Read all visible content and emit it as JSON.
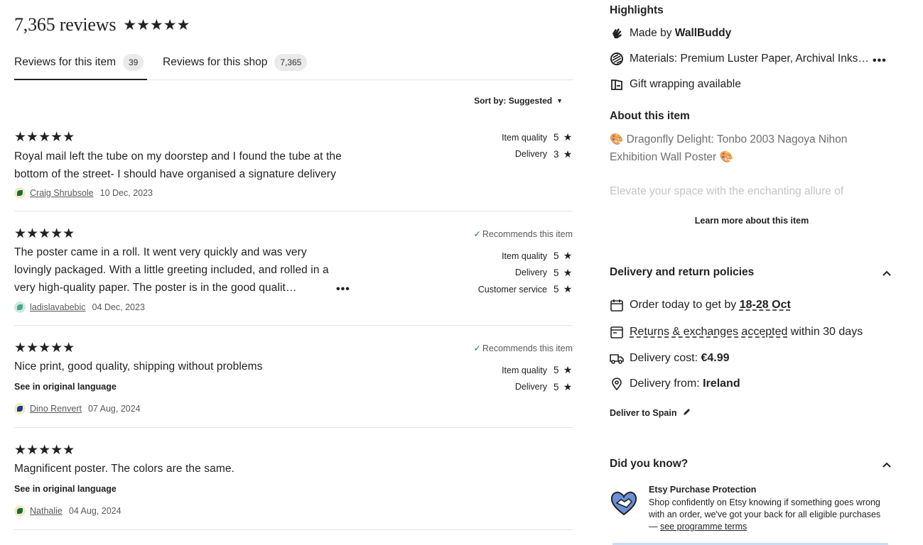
{
  "reviews_header": {
    "count_label": "7,365 reviews",
    "stars": "★★★★★"
  },
  "tabs": [
    {
      "label": "Reviews for this item",
      "count": "39"
    },
    {
      "label": "Reviews for this shop",
      "count": "7,365"
    }
  ],
  "sort": {
    "label": "Sort by: Suggested",
    "caret": "▼"
  },
  "reviews": [
    {
      "stars": "★★★★★",
      "text": "Royal mail left the tube on my doorstep and I found the tube at the bottom of the street- I should have organised a signature delivery",
      "author": "Craig Shrubsole",
      "date": "10 Dec, 2023",
      "ratings": [
        {
          "name": "Item quality",
          "value": "5"
        },
        {
          "name": "Delivery",
          "value": "3"
        }
      ]
    },
    {
      "stars": "★★★★★",
      "text": "The poster came in a roll. It went very quickly and was very lovingly packaged. With a little greeting included, and rolled in a very high-quality paper. The poster is in the good qualit…",
      "more": "•••",
      "author": "ladislavabebic",
      "date": "04 Dec, 2023",
      "recommends": "Recommends this item",
      "ratings": [
        {
          "name": "Item quality",
          "value": "5"
        },
        {
          "name": "Delivery",
          "value": "5"
        },
        {
          "name": "Customer service",
          "value": "5"
        }
      ]
    },
    {
      "stars": "★★★★★",
      "text": "Nice print, good quality, shipping without problems",
      "see_original": "See in original language",
      "author": "Dino Renvert",
      "date": "07 Aug, 2024",
      "recommends": "Recommends this item",
      "ratings": [
        {
          "name": "Item quality",
          "value": "5"
        },
        {
          "name": "Delivery",
          "value": "5"
        }
      ]
    },
    {
      "stars": "★★★★★",
      "text": "Magnificent poster. The colors are the same.",
      "see_original": "See in original language",
      "author": "Nathalie",
      "date": "04 Aug, 2024"
    }
  ],
  "details": {
    "highlights_title": "Highlights",
    "made_by_prefix": "Made by ",
    "made_by_shop": "WallBuddy",
    "materials": "Materials: Premium Luster Paper, Archival Inks, Acid-free",
    "materials_more": "•••",
    "gift_wrapping": "Gift wrapping available",
    "about_title": "About this item",
    "about_text": "🎨 Dragonfly Delight: Tonbo 2003 Nagoya Nihon Exhibition Wall Poster 🎨",
    "about_fade": "Elevate your space with the enchanting allure of",
    "learn_more": "Learn more about this item",
    "delivery_title": "Delivery and return policies",
    "order_prefix": "Order today to get by ",
    "order_dates": "18-28 Oct",
    "returns_link": "Returns & exchanges accepted",
    "returns_suffix": " within 30 days",
    "cost_prefix": "Delivery cost: ",
    "cost_value": "€4.99",
    "from_prefix": "Delivery from: ",
    "from_value": "Ireland",
    "deliver_to": "Deliver to Spain",
    "did_you_know": "Did you know?",
    "protection_title": "Etsy Purchase Protection",
    "protection_body": "Shop confidently on Etsy knowing if something goes wrong with an order, we've got your back for all eligible purchases — ",
    "protection_link": "see programme terms"
  },
  "colors": {
    "recommend_check": "#258635",
    "text": "#222222",
    "muted": "#595959",
    "divider": "#e1e3df"
  },
  "icons": [
    "hand-icon",
    "materials-icon",
    "gift-icon",
    "calendar-icon",
    "returns-icon",
    "truck-icon",
    "location-pin-icon",
    "pencil-icon",
    "chevron-up-icon",
    "heart-handshake-icon",
    "star-icon",
    "check-icon"
  ]
}
